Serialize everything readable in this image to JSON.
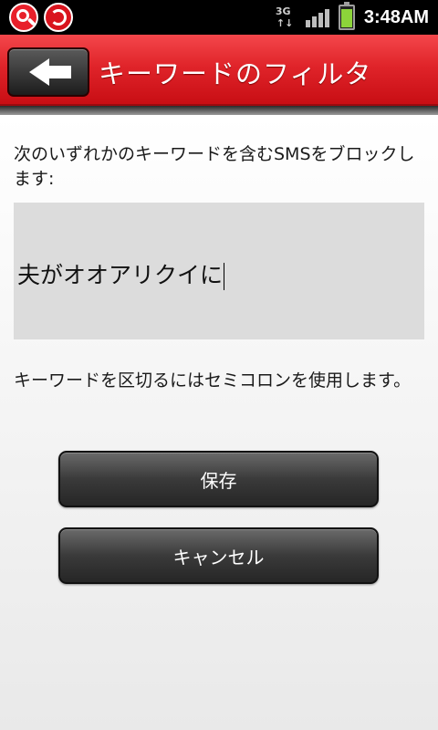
{
  "status_bar": {
    "network_label": "3G",
    "time": "3:48AM",
    "battery_color": "#8cd43a"
  },
  "header": {
    "title": "キーワードのフィルタ",
    "background_color": "#e0242a",
    "back_icon": "arrow-left-icon"
  },
  "main": {
    "instruction": "次のいずれかのキーワードを含むSMSをブロックします:",
    "keyword_value": "夫がオオアリクイに",
    "hint": "キーワードを区切るにはセミコロンを使用します。"
  },
  "buttons": {
    "save_label": "保存",
    "cancel_label": "キャンセル"
  }
}
